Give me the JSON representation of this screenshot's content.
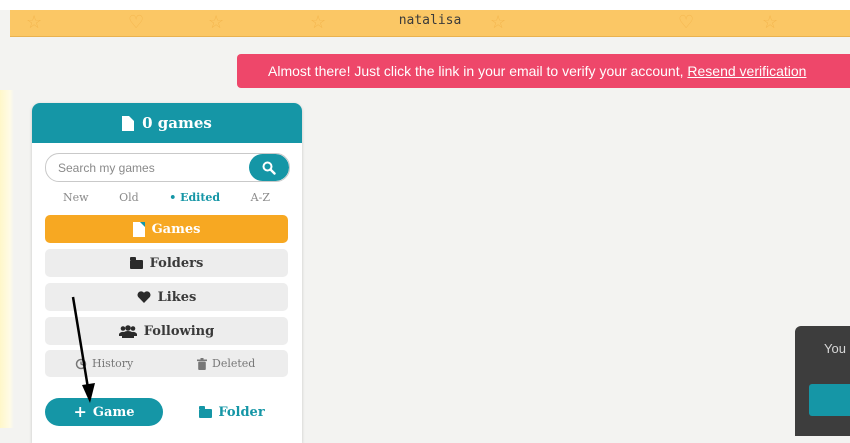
{
  "header": {
    "username": "natalisa"
  },
  "banner": {
    "message": "Almost there! Just click the link in your email to verify your account, ",
    "link": "Resend verification"
  },
  "panel": {
    "title": "0 games",
    "search": {
      "placeholder": "Search my games"
    },
    "sort": [
      "New",
      "Old",
      "• Edited",
      "A-Z"
    ],
    "nav": {
      "games": "Games",
      "folders": "Folders",
      "likes": "Likes",
      "following": "Following"
    },
    "history": "History",
    "deleted": "Deleted",
    "add_game": "Game",
    "add_folder": "Folder"
  },
  "toast": {
    "text": "You"
  },
  "colors": {
    "teal": "#1596a6",
    "orange": "#f7a822",
    "banner_pink": "#ee476a",
    "header_yellow": "#fbc765"
  }
}
